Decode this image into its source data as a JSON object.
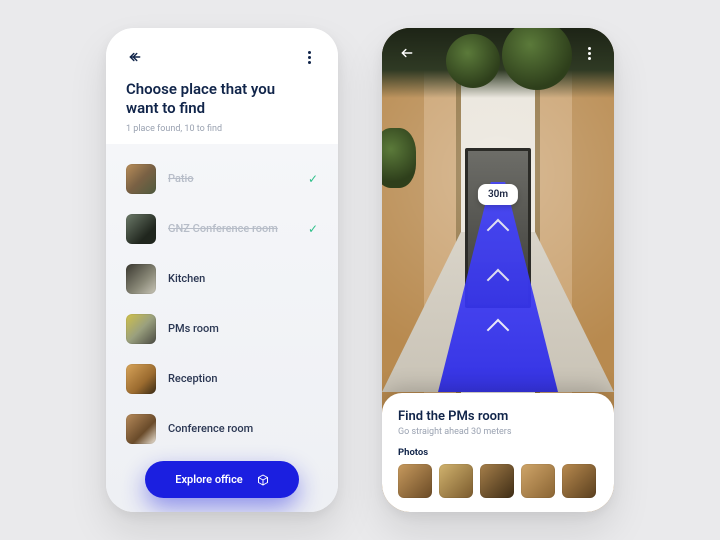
{
  "left": {
    "title": "Choose place that you want to find",
    "subtitle": "1 place found, 10 to find",
    "items": [
      {
        "label": "Patio",
        "done": true
      },
      {
        "label": "GNZ Conference room",
        "done": true
      },
      {
        "label": "Kitchen",
        "done": false
      },
      {
        "label": "PMs room",
        "done": false
      },
      {
        "label": "Reception",
        "done": false
      },
      {
        "label": "Conference room",
        "done": false
      }
    ],
    "cta": "Explore office"
  },
  "right": {
    "distance_badge": "30m",
    "card_title": "Find the PMs room",
    "card_sub": "Go straight ahead 30 meters",
    "photos_label": "Photos"
  },
  "colors": {
    "primary": "#1b1fe0",
    "text": "#11254a",
    "muted": "#9aa2b1",
    "success": "#2fc08a"
  }
}
